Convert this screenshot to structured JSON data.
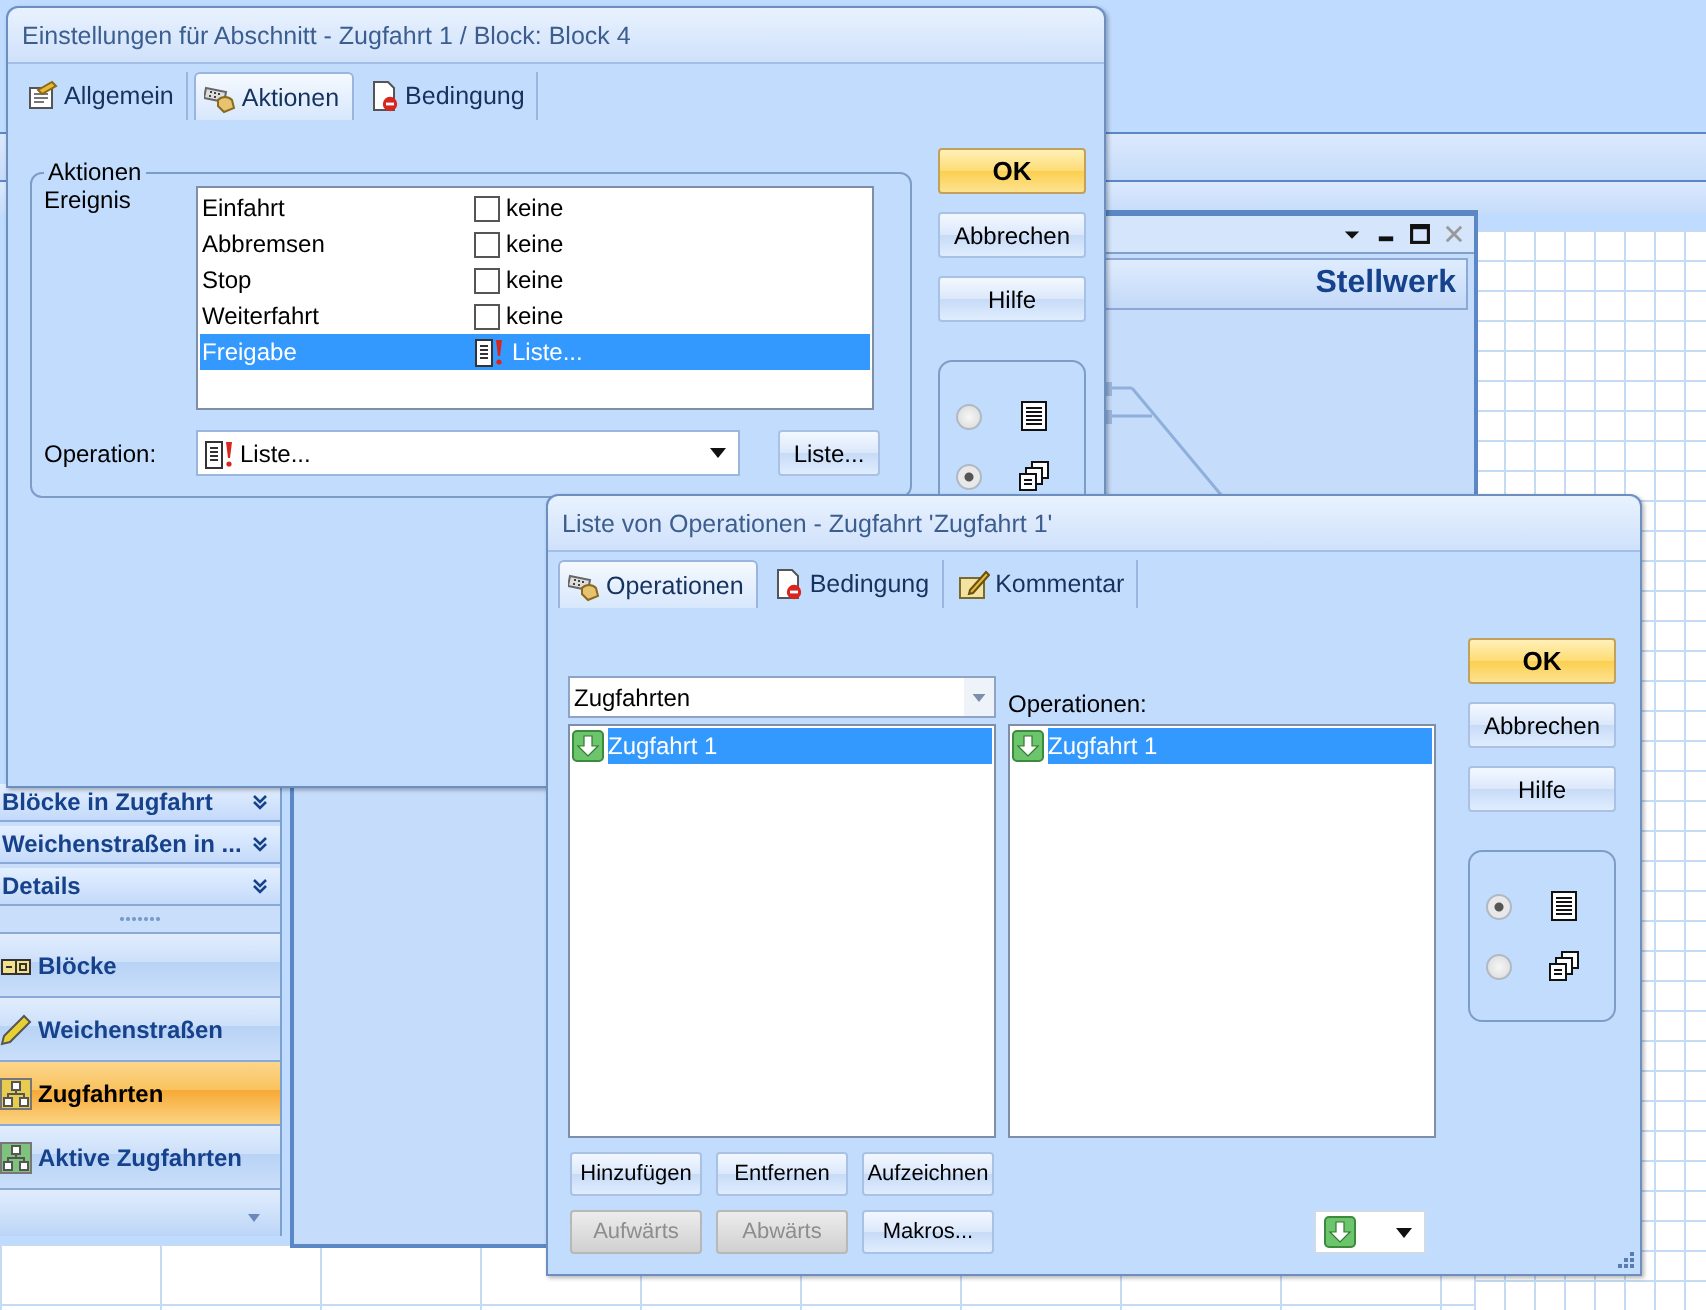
{
  "app": {
    "sidebar": {
      "sections": [
        {
          "label": "Blöcke in Zugfahrt"
        },
        {
          "label": "Weichenstraßen in ..."
        },
        {
          "label": "Details"
        }
      ],
      "nav": [
        {
          "label": "Blöcke",
          "selected": false
        },
        {
          "label": "Weichenstraßen",
          "selected": false
        },
        {
          "label": "Zugfahrten",
          "selected": true
        },
        {
          "label": "Aktive Zugfahrten",
          "selected": false
        }
      ]
    },
    "document_window": {
      "title": "Stellwerk"
    }
  },
  "settings_dialog": {
    "title": "Einstellungen für Abschnitt - Zugfahrt 1 / Block: Block 4",
    "tabs": [
      {
        "label": "Allgemein",
        "selected": false
      },
      {
        "label": "Aktionen",
        "selected": true
      },
      {
        "label": "Bedingung",
        "selected": false
      }
    ],
    "group_title": "Aktionen",
    "events_label": "Ereignis",
    "events": [
      {
        "name": "Einfahrt",
        "kind": "checkbox",
        "checked": false,
        "value": "keine",
        "selected": false
      },
      {
        "name": "Abbremsen",
        "kind": "checkbox",
        "checked": false,
        "value": "keine",
        "selected": false
      },
      {
        "name": "Stop",
        "kind": "checkbox",
        "checked": false,
        "value": "keine",
        "selected": false
      },
      {
        "name": "Weiterfahrt",
        "kind": "checkbox",
        "checked": false,
        "value": "keine",
        "selected": false
      },
      {
        "name": "Freigabe",
        "kind": "operation",
        "value": "Liste...",
        "selected": true
      }
    ],
    "operation_label": "Operation:",
    "operation_value": "Liste...",
    "list_button": "Liste...",
    "buttons": [
      {
        "label": "OK",
        "kind": "default"
      },
      {
        "label": "Abbrechen",
        "kind": "normal"
      },
      {
        "label": "Hilfe",
        "kind": "normal"
      }
    ],
    "views": [
      {
        "selected": false
      },
      {
        "selected": true
      }
    ]
  },
  "operations_dialog": {
    "title": "Liste von Operationen - Zugfahrt 'Zugfahrt 1'",
    "tabs": [
      {
        "label": "Operationen",
        "selected": true
      },
      {
        "label": "Bedingung",
        "selected": false
      },
      {
        "label": "Kommentar",
        "selected": false
      }
    ],
    "source_dropdown": "Zugfahrten",
    "source_items": [
      {
        "label": "Zugfahrt 1",
        "selected": true
      }
    ],
    "operations_label": "Operationen:",
    "operation_items": [
      {
        "label": "Zugfahrt 1",
        "selected": true
      }
    ],
    "action_buttons": [
      {
        "label": "Hinzufügen",
        "disabled": false
      },
      {
        "label": "Entfernen",
        "disabled": false
      },
      {
        "label": "Aufzeichnen",
        "disabled": false
      },
      {
        "label": "Aufwärts",
        "disabled": true
      },
      {
        "label": "Abwärts",
        "disabled": true
      },
      {
        "label": "Makros...",
        "disabled": false
      }
    ],
    "buttons": [
      {
        "label": "OK",
        "kind": "default"
      },
      {
        "label": "Abbrechen",
        "kind": "normal"
      },
      {
        "label": "Hilfe",
        "kind": "normal"
      }
    ],
    "views": [
      {
        "selected": true
      },
      {
        "selected": false
      }
    ]
  }
}
